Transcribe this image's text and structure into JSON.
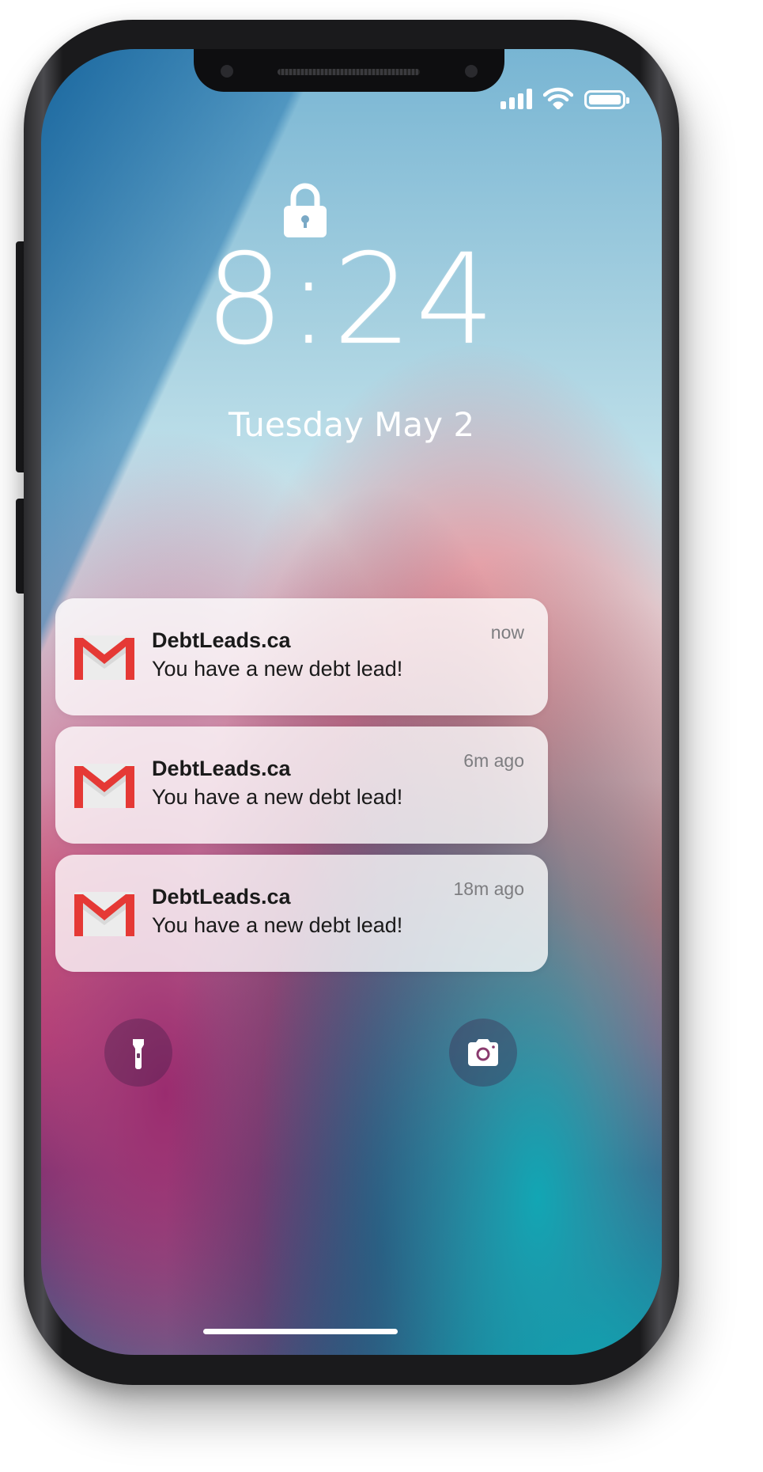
{
  "lock_screen": {
    "time": "8:24",
    "date": "Tuesday May 2"
  },
  "status_bar": {
    "icons": [
      "signal-icon",
      "wifi-icon",
      "battery-icon"
    ]
  },
  "notifications": [
    {
      "app_icon": "gmail-icon",
      "title": "DebtLeads.ca",
      "message": "You have a new debt lead!",
      "age": "now"
    },
    {
      "app_icon": "gmail-icon",
      "title": "DebtLeads.ca",
      "message": "You have a new debt lead!",
      "age": "6m ago"
    },
    {
      "app_icon": "gmail-icon",
      "title": "DebtLeads.ca",
      "message": "You have a new debt lead!",
      "age": "18m ago"
    }
  ],
  "quick_actions": [
    "flashlight-icon",
    "camera-icon"
  ],
  "colors": {
    "gmail_red": "#e53935",
    "notification_text": "#1a1a1a",
    "notification_age": "#7d7d80"
  }
}
